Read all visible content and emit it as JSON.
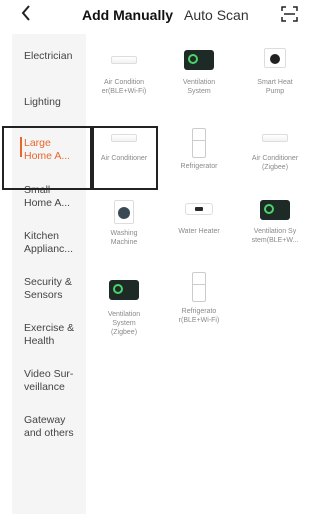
{
  "header": {
    "back_icon": "chevron-left-icon",
    "tabs": [
      "Add Manually",
      "Auto Scan"
    ],
    "scan_icon": "scan-frame-icon"
  },
  "sidebar": {
    "accent_color": "#e8662e",
    "items": [
      {
        "label": "Electrician"
      },
      {
        "label": "Lighting"
      },
      {
        "label": "Large\nHome A...",
        "active": true
      },
      {
        "label": "Small\nHome A..."
      },
      {
        "label": "Kitchen\nApplianc..."
      },
      {
        "label": "Security &\nSensors"
      },
      {
        "label": "Exercise &\nHealth"
      },
      {
        "label": "Video Sur-\nveillance"
      },
      {
        "label": "Gateway\nand others"
      }
    ]
  },
  "grid": {
    "items": [
      {
        "label": "Air Condition\ner(BLE+Wi-Fi)",
        "icon": "air-conditioner-icon"
      },
      {
        "label": "Ventilation\nSystem",
        "icon": "ventilation-system-icon"
      },
      {
        "label": "Smart Heat\nPump",
        "icon": "heat-pump-icon"
      },
      {
        "label": "Air Conditioner",
        "icon": "air-conditioner-icon"
      },
      {
        "label": "Refrigerator",
        "icon": "refrigerator-icon"
      },
      {
        "label": "Air Conditioner\n(Zigbee)",
        "icon": "air-conditioner-icon"
      },
      {
        "label": "Washing\nMachine",
        "icon": "washing-machine-icon"
      },
      {
        "label": "Water Heater",
        "icon": "water-heater-icon"
      },
      {
        "label": "Ventilation Sy\nstem(BLE+W...",
        "icon": "ventilation-system-icon"
      },
      {
        "label": "Ventilation\nSystem\n(Zigbee)",
        "icon": "ventilation-system-icon"
      },
      {
        "label": "Refrigerato\nr(BLE+Wi-Fi)",
        "icon": "refrigerator-icon"
      }
    ]
  }
}
